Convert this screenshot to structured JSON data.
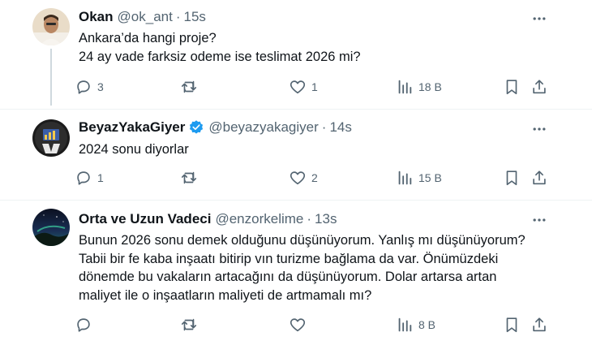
{
  "tweets": [
    {
      "name": "Okan",
      "handle": "@ok_ant",
      "time": "15s",
      "lines": [
        "Ankara’da hangi proje?",
        "24 ay vade farksiz odeme ise teslimat 2026 mi?"
      ],
      "replies": "3",
      "retweets": "",
      "likes": "1",
      "views": "18 B"
    },
    {
      "name": "BeyazYakaGiyer",
      "handle": "@beyazyakagiyer",
      "time": "14s",
      "verified": true,
      "lines": [
        "2024 sonu diyorlar"
      ],
      "replies": "1",
      "retweets": "",
      "likes": "2",
      "views": "15 B"
    },
    {
      "name": "Orta ve Uzun Vadeci",
      "handle": "@enzorkelime",
      "time": "13s",
      "lines": [
        "Bunun 2026 sonu demek olduğunu düşünüyorum.  Yanlış mı düşünüyorum?",
        "Tabii bir fe kaba inşaatı bitirip vın turizme bağlama da var. Önümüzdeki",
        "dönemde bu vakaların artacağını da düşünüyorum. Dolar artarsa artan",
        "maliyet ile o inşaatların maliyeti de artmamalı mı?"
      ],
      "replies": "",
      "retweets": "",
      "likes": "",
      "views": "8 B"
    }
  ],
  "colors": {
    "text": "#0f1419",
    "secondary": "#536471",
    "verified": "#1d9bf0",
    "divider": "#eff3f4"
  },
  "icons": [
    "reply-icon",
    "retweet-icon",
    "like-icon",
    "views-icon",
    "bookmark-icon",
    "share-icon",
    "more-icon",
    "verified-badge-icon"
  ]
}
